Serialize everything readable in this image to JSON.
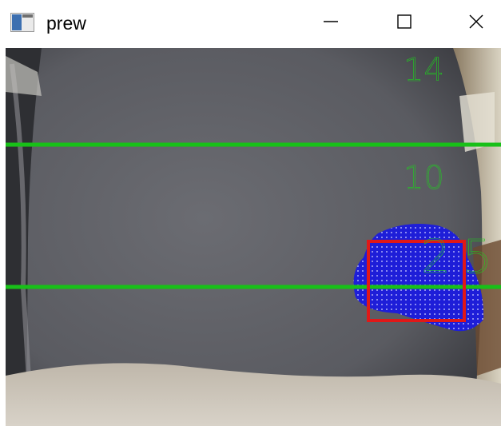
{
  "window": {
    "title": "prew",
    "icon": "app-window-icon",
    "controls": {
      "minimize_icon": "minimize-icon",
      "maximize_icon": "maximize-icon",
      "close_icon": "close-icon"
    }
  },
  "preview": {
    "distance_labels": [
      "14",
      "10",
      "2",
      "5"
    ],
    "line_color": "#18c018",
    "label_color": "#1ed01e",
    "detection_box_color": "#e01818",
    "blob_color": "#1e1ed8"
  }
}
